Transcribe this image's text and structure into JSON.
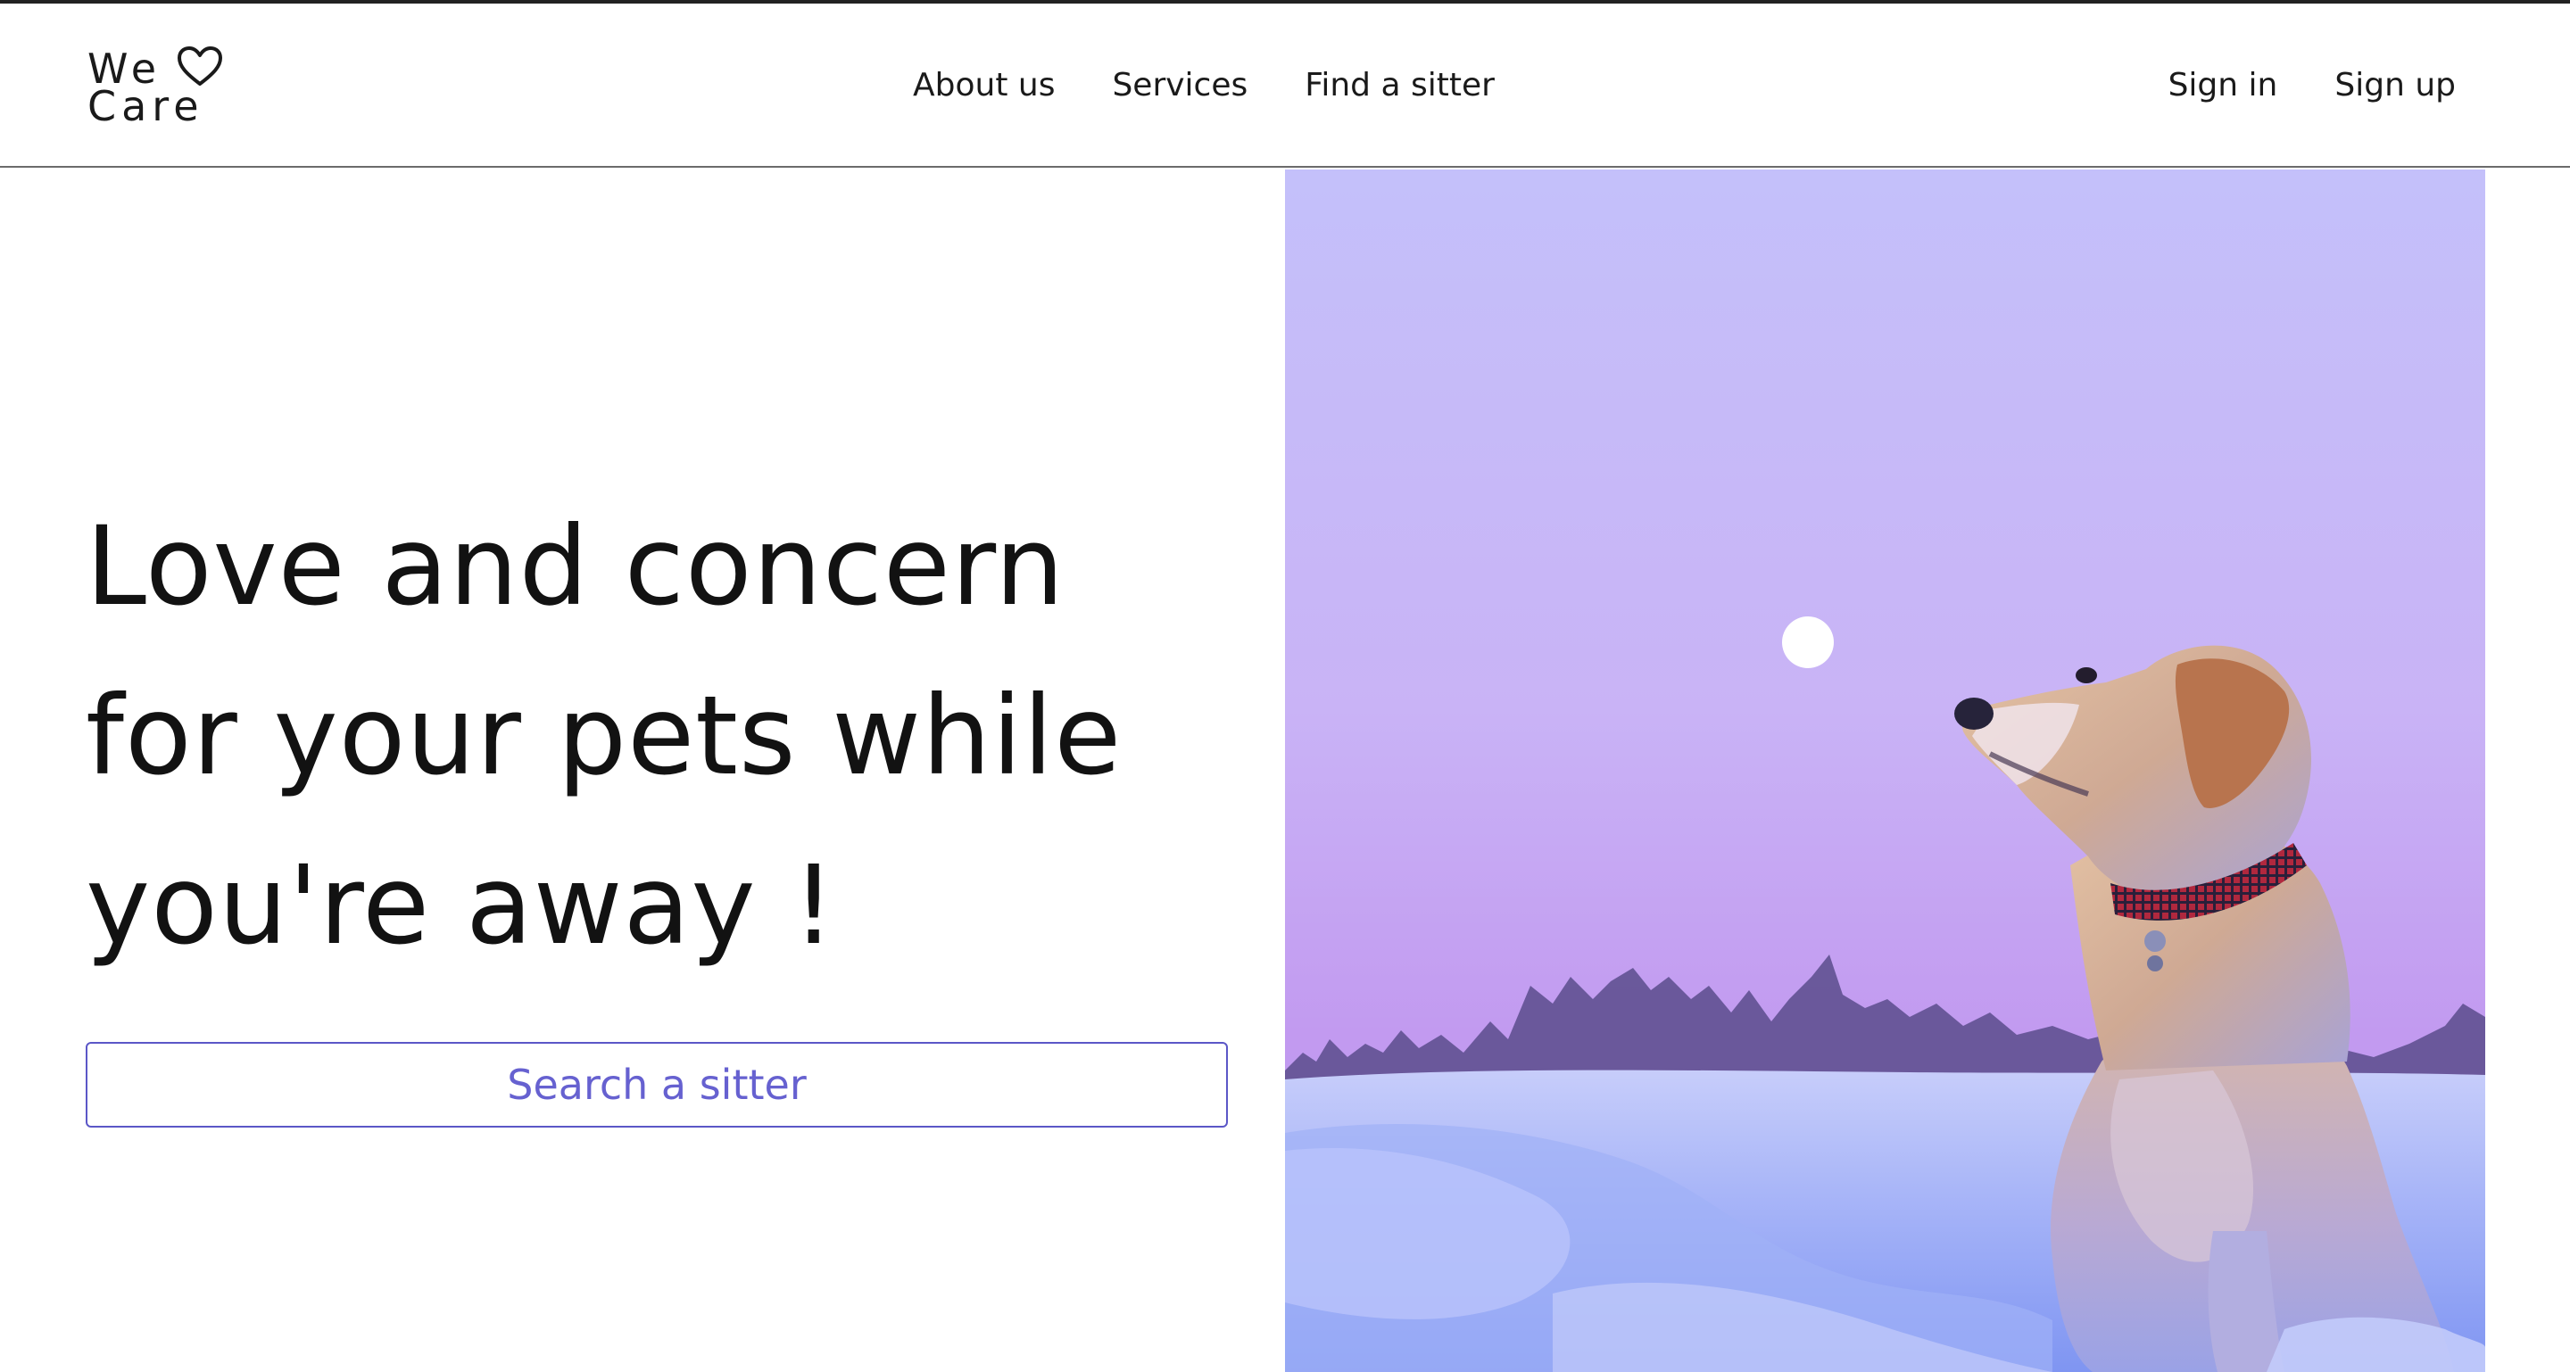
{
  "header": {
    "logo": {
      "line1": "We",
      "line2": "Care",
      "icon": "heart-icon"
    },
    "nav_links": [
      "About us",
      "Services",
      "Find a sitter"
    ],
    "auth_links": {
      "sign_in": "Sign in",
      "sign_up": "Sign up"
    }
  },
  "hero": {
    "title_lines": [
      "Love and concern",
      "for your pets while",
      "you're away !"
    ],
    "search_button": "Search a sitter",
    "image": {
      "subject": "dog-sitting-in-snow-photo",
      "colors": {
        "sky_top": "#c4c0fa",
        "sky_mid": "#c7a8f3",
        "sky_low": "#b58ff0",
        "snow": "#8aa0f6",
        "moon": "#ffffff"
      }
    }
  },
  "colors": {
    "accent": "#5b57c7",
    "accent_text": "#6661d0",
    "text": "#121212",
    "divider": "#6b6b6b"
  }
}
